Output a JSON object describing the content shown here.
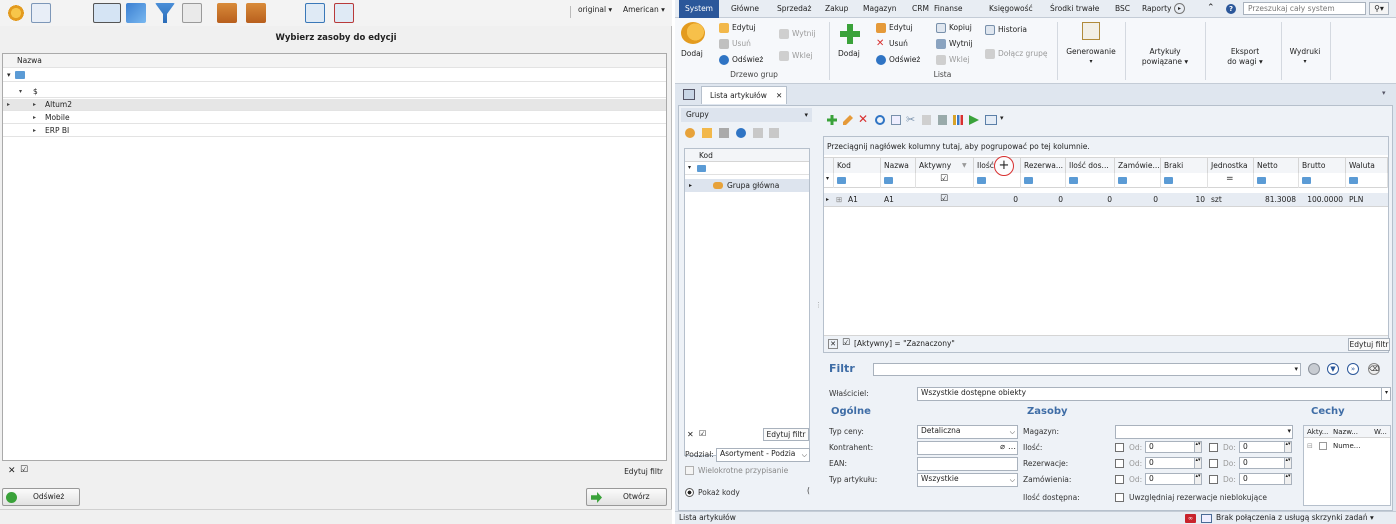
{
  "left": {
    "toolbar": {
      "original_label": "original",
      "language_label": "American"
    },
    "title": "Wybierz zasoby do edycji",
    "grid": {
      "column_header": "Nazwa",
      "filter_placeholder": "",
      "root": "$",
      "items": [
        "Altum2",
        "Mobile",
        "ERP BI"
      ]
    },
    "edit_filter": "Edytuj filtr",
    "refresh_button": "Odśwież",
    "open_button": "Otwórz"
  },
  "menu": {
    "items": [
      "System",
      "Główne",
      "Sprzedaż",
      "Zakup",
      "Magazyn",
      "CRM",
      "Finanse",
      "Księgowość",
      "Środki trwałe",
      "BSC",
      "Raporty"
    ],
    "search_placeholder": "Przeszukaj cały system"
  },
  "ribbon": {
    "drzewo_grup": {
      "add": "Dodaj",
      "edit": "Edytuj",
      "delete": "Usuń",
      "refresh": "Odśwież",
      "cut": "Wytnij",
      "paste": "Wklej",
      "label": "Drzewo grup"
    },
    "lista": {
      "add": "Dodaj",
      "edit": "Edytuj",
      "delete": "Usuń",
      "refresh": "Odśwież",
      "copy": "Kopiuj",
      "cut": "Wytnij",
      "paste": "Wklej",
      "history": "Historia",
      "join_group": "Dołącz grupę",
      "label": "Lista"
    },
    "generate": "Generowanie",
    "related_line1": "Artykuły",
    "related_line2": "powiązane",
    "export_line1": "Eksport",
    "export_line2": "do wagi",
    "prints": "Wydruki"
  },
  "doc_tab": "Lista artykułów",
  "groups": {
    "title": "Grupy",
    "column": "Kod",
    "root_item": "Grupa główna",
    "edit_filter": "Edytuj filtr",
    "division_label": "Podział:",
    "division_value": "Asortyment - Podzia",
    "multi_assign": "Wielokrotne przypisanie",
    "show_codes": "Pokaż kody"
  },
  "articles": {
    "drag_hint": "Przeciągnij nagłówek kolumny tutaj, aby pogrupować po tej kolumnie.",
    "columns": [
      "Kod",
      "Nazwa",
      "Aktywny",
      "Ilość",
      "Rezerwa...",
      "Ilość dos...",
      "Zamówie...",
      "Braki",
      "Jednostka",
      "Netto",
      "Brutto",
      "Waluta"
    ],
    "rows": [
      {
        "kod": "A1",
        "nazwa": "A1",
        "aktywny": true,
        "ilosc": "0",
        "rezerwacje": "0",
        "ilosc_dost": "0",
        "zamowienia": "0",
        "braki": "10",
        "jednostka": "szt",
        "netto": "81.3008",
        "brutto": "100.0000",
        "waluta": "PLN"
      }
    ],
    "filter_expr": "[Aktywny] = \"Zaznaczony\"",
    "edit_filter": "Edytuj filtr"
  },
  "filter_panel": {
    "title": "Filtr",
    "owner_label": "Właściciel:",
    "owner_value": "Wszystkie dostępne obiekty",
    "general_section": "Ogólne",
    "resources_section": "Zasoby",
    "features_section": "Cechy",
    "price_type_label": "Typ ceny:",
    "price_type_value": "Detaliczna",
    "contractor_label": "Kontrahent:",
    "ean_label": "EAN:",
    "article_type_label": "Typ artykułu:",
    "article_type_value": "Wszystkie",
    "warehouse_label": "Magazyn:",
    "qty_label": "Ilość:",
    "reservations_label": "Rezerwacje:",
    "orders_label": "Zamówienia:",
    "available_label": "Ilość dostępna:",
    "from_label": "Od:",
    "to_label": "Do:",
    "zero": "0",
    "non_blocking": "Uwzględniaj rezerwacje nieblokujące",
    "features_cols": [
      "Akty...",
      "Nazw...",
      "W..."
    ],
    "features_row": "Nume..."
  },
  "status": {
    "left": "Lista artykułów",
    "right": "Brak połączenia z usługą skrzynki zadań"
  },
  "colors": {
    "system_tab": "#2b579a",
    "accent": "#3f6da6",
    "green": "#3aa23a",
    "red": "#d83030"
  }
}
